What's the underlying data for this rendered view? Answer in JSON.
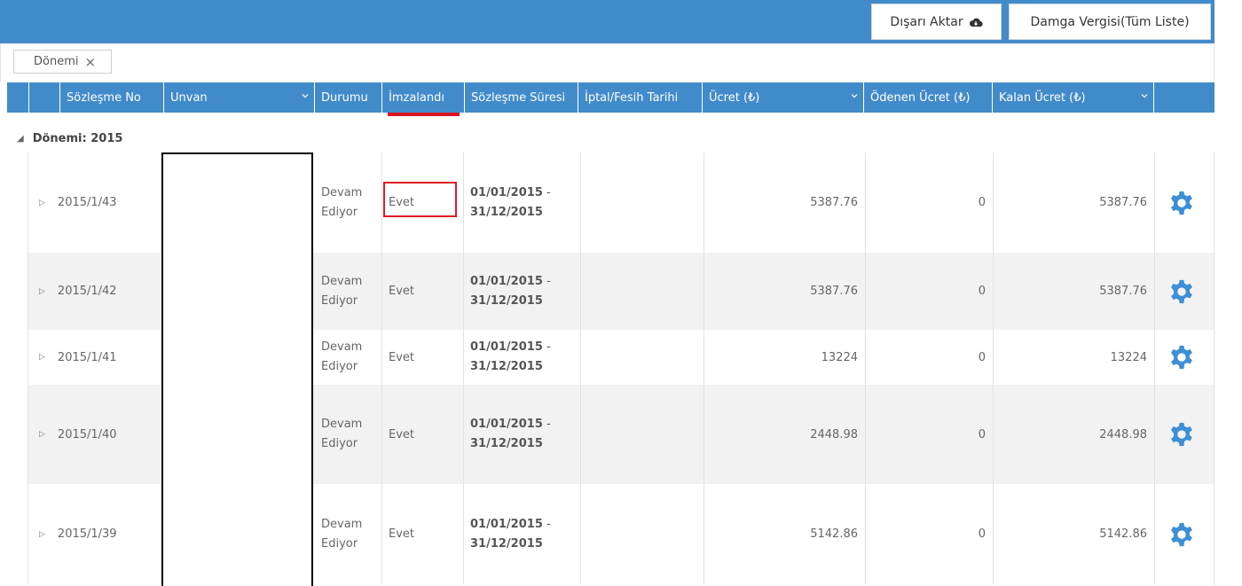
{
  "toolbar": {
    "export_label": "Dışarı Aktar",
    "stamp_label": "Damga Vergisi(Tüm Liste)"
  },
  "grouping": {
    "chip_label": "Dönemi",
    "group_header": "Dönemi: 2015"
  },
  "columns": [
    {
      "key": "no",
      "label": "Sözleşme No"
    },
    {
      "key": "unvan",
      "label": "Unvan"
    },
    {
      "key": "durum",
      "label": "Durumu"
    },
    {
      "key": "imza",
      "label": "İmzalandı"
    },
    {
      "key": "sure",
      "label": "Sözleşme Süresi"
    },
    {
      "key": "iptal",
      "label": "İptal/Fesih Tarihi"
    },
    {
      "key": "ucret",
      "label": "Ücret (₺)"
    },
    {
      "key": "odenen",
      "label": "Ödenen Ücret (₺)"
    },
    {
      "key": "kalan",
      "label": "Kalan Ücret (₺)"
    }
  ],
  "rows": [
    {
      "no": "2015/1/43",
      "durum1": "Devam",
      "durum2": "Ediyor",
      "imza": "Evet",
      "start": "01/01/2015",
      "end": "31/12/2015",
      "ucret": "5387.76",
      "odenen": "0",
      "kalan": "5387.76"
    },
    {
      "no": "2015/1/42",
      "durum1": "Devam",
      "durum2": "Ediyor",
      "imza": "Evet",
      "start": "01/01/2015",
      "end": "31/12/2015",
      "ucret": "5387.76",
      "odenen": "0",
      "kalan": "5387.76"
    },
    {
      "no": "2015/1/41",
      "durum1": "Devam",
      "durum2": "Ediyor",
      "imza": "Evet",
      "start": "01/01/2015",
      "end": "31/12/2015",
      "ucret": "13224",
      "odenen": "0",
      "kalan": "13224"
    },
    {
      "no": "2015/1/40",
      "durum1": "Devam",
      "durum2": "Ediyor",
      "imza": "Evet",
      "start": "01/01/2015",
      "end": "31/12/2015",
      "ucret": "2448.98",
      "odenen": "0",
      "kalan": "2448.98"
    },
    {
      "no": "2015/1/39",
      "durum1": "Devam",
      "durum2": "Ediyor",
      "imza": "Evet",
      "start": "01/01/2015",
      "end": "31/12/2015",
      "ucret": "5142.86",
      "odenen": "0",
      "kalan": "5142.86"
    }
  ],
  "icons": {
    "cloud": "cloud-icon",
    "gear": "gear-icon",
    "close": "close-icon",
    "expand": "expand-arrow-icon",
    "collapse": "collapse-triangle-icon",
    "chevron": "chevron-down-icon"
  },
  "colors": {
    "header_blue": "#428bca",
    "highlight_red": "#e01b24",
    "gear_blue": "#3d8fd6"
  }
}
